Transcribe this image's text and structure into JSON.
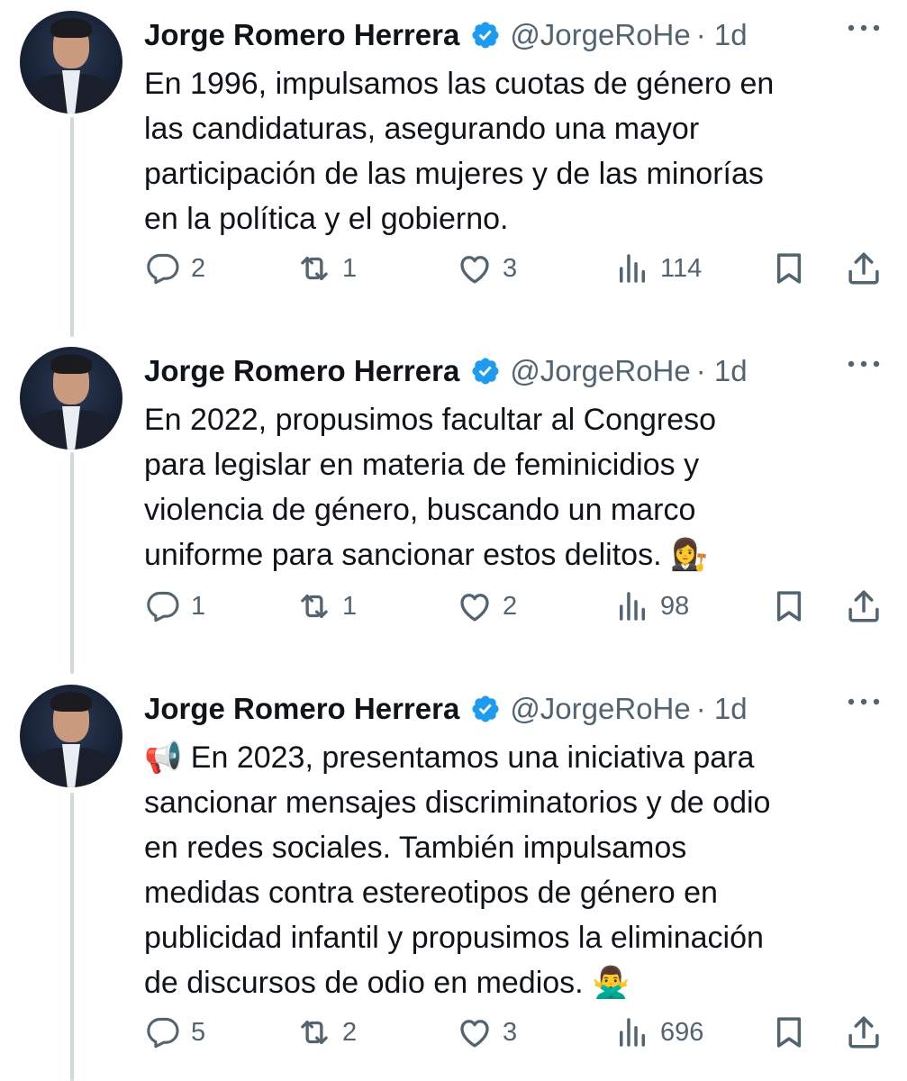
{
  "tweets": [
    {
      "author": "Jorge Romero Herrera",
      "handle": "@JorgeRoHe",
      "time": "· 1d",
      "text": "En 1996, impulsamos las cuotas de género en las candidaturas, asegurando una mayor participación de las mujeres y de las minorías en la política y el gobierno.",
      "text_lines": [
        "En 1996, impulsamos las cuotas de género en",
        "las candidaturas, asegurando una mayor",
        "participación de las mujeres y de las minorías",
        "en la política y el gobierno."
      ],
      "replies": "2",
      "reposts": "1",
      "likes": "3",
      "views": "114"
    },
    {
      "author": "Jorge Romero Herrera",
      "handle": "@JorgeRoHe",
      "time": "· 1d",
      "text": "En 2022, propusimos facultar al Congreso para legislar en materia de feminicidios y violencia de género, buscando un marco uniforme para sancionar estos delitos. 👩‍⚖️",
      "text_lines": [
        "En 2022, propusimos facultar al Congreso",
        "para legislar en materia de feminicidios y",
        "violencia de género, buscando un marco",
        "uniforme para sancionar estos delitos. 👩‍⚖️"
      ],
      "replies": "1",
      "reposts": "1",
      "likes": "2",
      "views": "98"
    },
    {
      "author": "Jorge Romero Herrera",
      "handle": "@JorgeRoHe",
      "time": "· 1d",
      "text": "📢 En 2023, presentamos una iniciativa para sancionar mensajes discriminatorios y de odio en redes sociales. También impulsamos medidas contra estereotipos de género en publicidad infantil y propusimos la eliminación de discursos de odio en medios. 🙅‍♂️",
      "text_lines": [
        "📢 En 2023, presentamos una iniciativa para",
        "sancionar mensajes discriminatorios y de odio",
        "en redes sociales. También impulsamos",
        "medidas contra estereotipos de género en",
        "publicidad infantil y propusimos la eliminación",
        "de discursos de odio en medios. 🙅‍♂️"
      ],
      "replies": "5",
      "reposts": "2",
      "likes": "3",
      "views": "696"
    }
  ],
  "icons": {
    "verified": "verified-badge-icon",
    "more": "more-options-icon",
    "reply": "reply-icon",
    "repost": "repost-icon",
    "like": "like-icon",
    "views": "views-icon",
    "bookmark": "bookmark-icon",
    "share": "share-icon"
  },
  "colors": {
    "verified": "#1d9bf0",
    "muted": "#536471",
    "text": "#0f1419",
    "thread_line": "#cfd9de"
  }
}
